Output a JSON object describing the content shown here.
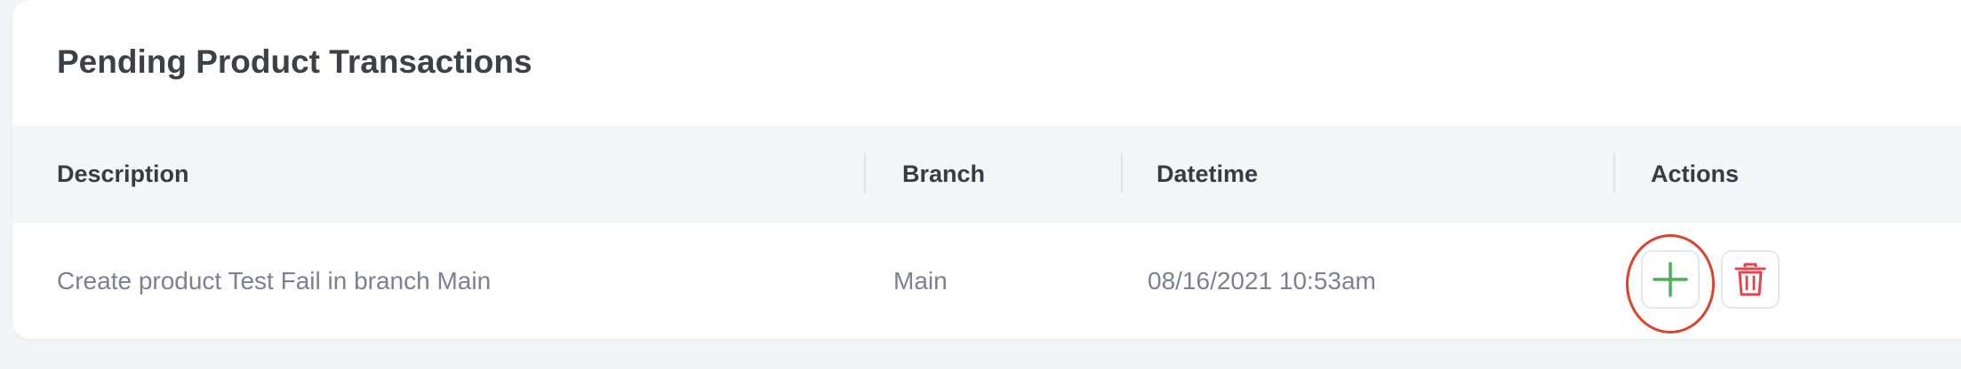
{
  "card": {
    "title": "Pending Product Transactions"
  },
  "table": {
    "columns": [
      {
        "key": "description",
        "label": "Description"
      },
      {
        "key": "branch",
        "label": "Branch"
      },
      {
        "key": "datetime",
        "label": "Datetime"
      },
      {
        "key": "actions",
        "label": "Actions"
      }
    ],
    "rows": [
      {
        "description": "Create product Test Fail in branch Main",
        "branch": "Main",
        "datetime": "08/16/2021 10:53am",
        "actions": [
          {
            "name": "approve",
            "icon": "plus-icon",
            "color": "#4caf5a"
          },
          {
            "name": "delete",
            "icon": "trash-icon",
            "color": "#e0454f"
          }
        ]
      }
    ]
  },
  "annotation": {
    "highlight_color": "#e0412a"
  }
}
